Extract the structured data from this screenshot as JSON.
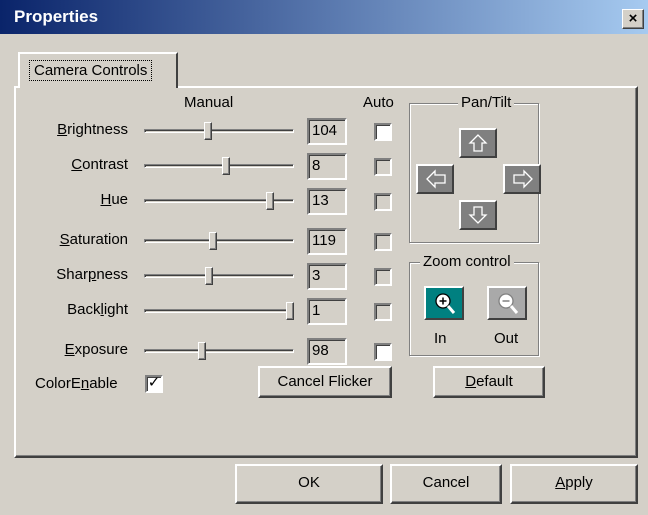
{
  "window": {
    "title": "Properties",
    "close_glyph": "×"
  },
  "tab": {
    "label": "Camera Controls"
  },
  "headers": {
    "manual": "Manual",
    "auto": "Auto"
  },
  "controls": [
    {
      "label": "Brightness",
      "underline": "B",
      "rest": "rightness",
      "value": "104",
      "slider_fraction": 0.42,
      "auto": false,
      "auto_enabled": true
    },
    {
      "label": "Contrast",
      "underline": "C",
      "rest": "ontrast",
      "value": "8",
      "slider_fraction": 0.55,
      "auto": false,
      "auto_enabled": false
    },
    {
      "label": "Hue",
      "underline": "H",
      "rest": "ue",
      "value": "13",
      "slider_fraction": 0.86,
      "auto": false,
      "auto_enabled": false
    },
    {
      "label": "Saturation",
      "underline": "S",
      "rest": "aturation",
      "value": "119",
      "slider_fraction": 0.46,
      "auto": false,
      "auto_enabled": false
    },
    {
      "label": "Sharpness",
      "pre": "Shar",
      "underline": "p",
      "rest": "ness",
      "value": "3",
      "slider_fraction": 0.43,
      "auto": false,
      "auto_enabled": false
    },
    {
      "label": "Backlight",
      "pre": "Back",
      "underline": "l",
      "rest": "ight",
      "value": "1",
      "slider_fraction": 1.0,
      "auto": false,
      "auto_enabled": false
    },
    {
      "label": "Exposure",
      "underline": "E",
      "rest": "xposure",
      "value": "98",
      "slider_fraction": 0.38,
      "auto": false,
      "auto_enabled": true
    }
  ],
  "color_enable": {
    "pre": "ColorE",
    "underline": "n",
    "rest": "able",
    "checked": true,
    "check_glyph": "✓"
  },
  "pan_tilt": {
    "title": "Pan/Tilt",
    "up_icon": "arrow-up-icon",
    "left_icon": "arrow-left-icon",
    "right_icon": "arrow-right-icon",
    "down_icon": "arrow-down-icon"
  },
  "zoom": {
    "title": "Zoom control",
    "in_label": "In",
    "out_label": "Out",
    "in_icon": "zoom-in-icon",
    "out_icon": "zoom-out-icon",
    "in_color": "#008080"
  },
  "buttons": {
    "cancel_flicker": "Cancel Flicker",
    "default_underline": "D",
    "default_rest": "efault",
    "ok": "OK",
    "cancel": "Cancel",
    "apply_underline": "A",
    "apply_rest": "pply"
  }
}
